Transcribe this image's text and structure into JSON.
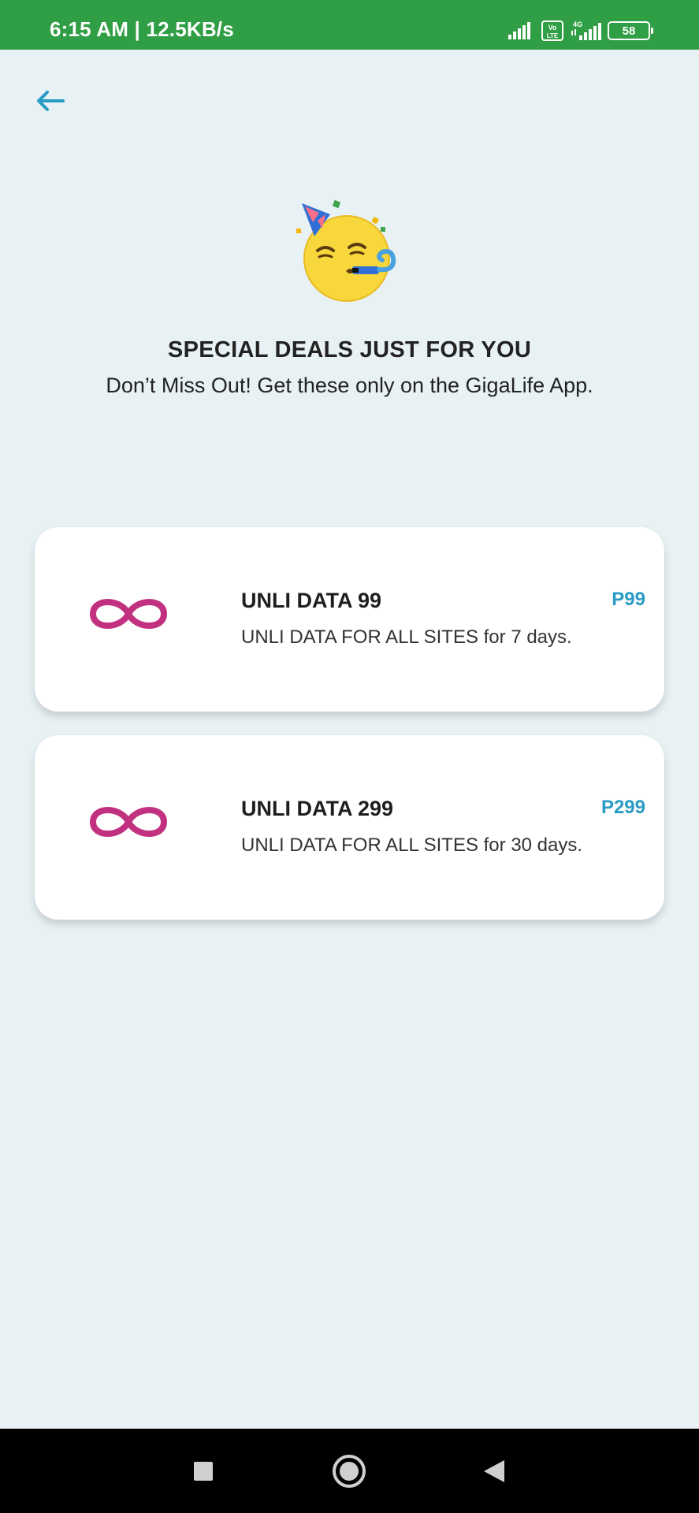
{
  "status_bar": {
    "time_speed": "6:15 AM | 12.5KB/s",
    "volte_label": "Vo LTE",
    "network_label": "4G",
    "battery": "58"
  },
  "header": {
    "back_icon": "arrow-left-icon",
    "accent_color": "#2a9bc4"
  },
  "hero": {
    "emoji": "partying-face",
    "title": "SPECIAL DEALS JUST FOR YOU",
    "subtitle": "Don’t Miss Out! Get these only on the GigaLife App."
  },
  "offers": [
    {
      "icon": "infinity-icon",
      "title": "UNLI DATA 99",
      "description": "UNLI DATA FOR ALL SITES for 7 days.",
      "price": "P99"
    },
    {
      "icon": "infinity-icon",
      "title": "UNLI DATA 299",
      "description": "UNLI DATA FOR ALL SITES for 30 days.",
      "price": "P299"
    }
  ],
  "colors": {
    "status_bar": "#2f9e44",
    "background": "#e8f1f4",
    "infinity": "#c2317f",
    "price": "#2a9bc4"
  },
  "nav_bar": {
    "buttons": [
      "recents-square-icon",
      "home-circle-icon",
      "back-triangle-icon"
    ]
  }
}
